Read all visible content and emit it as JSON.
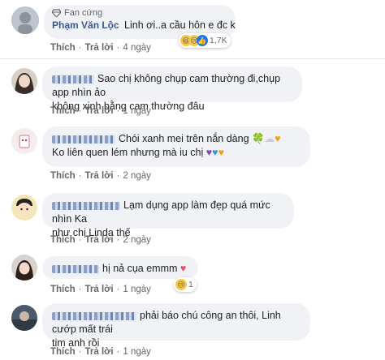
{
  "top_comment": {
    "badge": "Fan cứng",
    "author": "Phạm Văn Lộc",
    "text": "Linh ơi..a cầu hôn e đc k",
    "reaction_count": "1,7K",
    "like": "Thích",
    "reply": "Trả lời",
    "time": "4 ngày"
  },
  "comments": [
    {
      "text_line1": "Sao chị không chụp cam thường đi,chụp app nhìn ảo",
      "text_line2": "không xinh bằng cam thường đâu",
      "like": "Thích",
      "reply": "Trả lời",
      "time": "1 ngày"
    },
    {
      "text_line1": "Chói xanh mei trên nắn dàng",
      "text_line2": "Ko liên quen lém nhưng mà iu chị",
      "like": "Thích",
      "reply": "Trả lời",
      "time": "2 ngày"
    },
    {
      "text_line1": "Lạm dụng app làm đẹp quá mức nhìn Ka",
      "text_line2": "như chị Linda thế",
      "like": "Thích",
      "reply": "Trả lời",
      "time": "2 ngày"
    },
    {
      "text_line1": "hị nả cụa emmm",
      "like": "Thích",
      "reply": "Trả lời",
      "time": "1 ngày",
      "reaction_count": "1"
    },
    {
      "text_line1": "phải báo chú công an thôi, Linh cướp mất trái",
      "text_line2": "tim anh rồi",
      "like": "Thích",
      "reply": "Trả lời",
      "time": "1 ngày"
    }
  ],
  "colors": {
    "author": "#385898",
    "bubble": "#f0f2f5",
    "meta": "#65676b"
  }
}
